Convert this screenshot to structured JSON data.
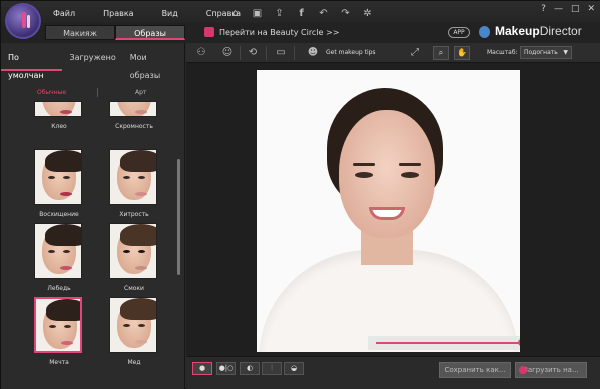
{
  "menu": {
    "file": "Файл",
    "edit": "Правка",
    "view": "Вид",
    "help": "Справка"
  },
  "title_icons": [
    "home-icon",
    "save-icon",
    "share-icon",
    "facebook-icon",
    "undo-icon",
    "redo-icon",
    "settings-icon"
  ],
  "window_controls": {
    "help": "?",
    "minimize": "—",
    "maximize": "□",
    "close": "✕"
  },
  "tabs": {
    "makeup": "Макияж",
    "looks": "Образы"
  },
  "beauty_circle": "Перейти на Beauty Circle >>",
  "app_badge": "APP",
  "brand": {
    "bold": "Makeup",
    "light": "Director"
  },
  "subtabs": {
    "default": "По умолчан",
    "loaded": "Загружено",
    "my_looks": "Мои образы"
  },
  "categories": {
    "regular": "Обычные",
    "art": "Арт"
  },
  "looks": [
    {
      "label": "Клео"
    },
    {
      "label": "Скромность"
    },
    {
      "label": "Восхищение"
    },
    {
      "label": "Хитрость"
    },
    {
      "label": "Лебедь"
    },
    {
      "label": "Смоки"
    },
    {
      "label": "Мечта"
    },
    {
      "label": "Мед"
    }
  ],
  "toolbar": {
    "tips": "Get makeup tips",
    "zoom_label": "Масштаб:",
    "zoom_value": "Подогнать"
  },
  "slider": {
    "value": 0.88
  },
  "bottom": {
    "save": "Сохранить как...",
    "upload": "Загрузить на..."
  },
  "colors": {
    "accent": "#e24676",
    "brand_pink": "#d7376c"
  }
}
